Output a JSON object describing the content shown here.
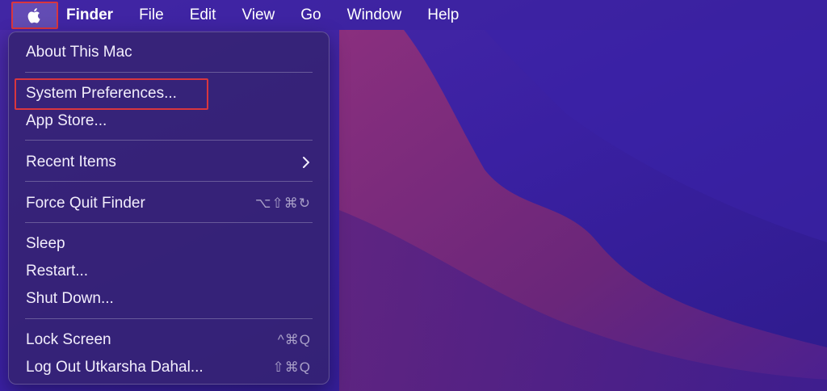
{
  "menubar": {
    "apple_icon": "apple-logo-icon",
    "app_name": "Finder",
    "menus": [
      "File",
      "Edit",
      "View",
      "Go",
      "Window",
      "Help"
    ]
  },
  "apple_menu": {
    "items": [
      {
        "label": "About This Mac"
      },
      {
        "label": "System Preferences..."
      },
      {
        "label": "App Store..."
      },
      {
        "label": "Recent Items",
        "submenu_icon": "chevron-right-icon"
      },
      {
        "label": "Force Quit Finder",
        "shortcut": "⌥⇧⌘↻"
      },
      {
        "label": "Sleep"
      },
      {
        "label": "Restart..."
      },
      {
        "label": "Shut Down..."
      },
      {
        "label": "Lock Screen",
        "shortcut": "^⌘Q"
      },
      {
        "label": "Log Out Utkarsha Dahal...",
        "shortcut": "⇧⌘Q"
      }
    ]
  },
  "colors": {
    "annotation_highlight": "#d9363e",
    "desktop_blue": "#3a1f9a",
    "desktop_magenta": "#7c2a7e"
  }
}
